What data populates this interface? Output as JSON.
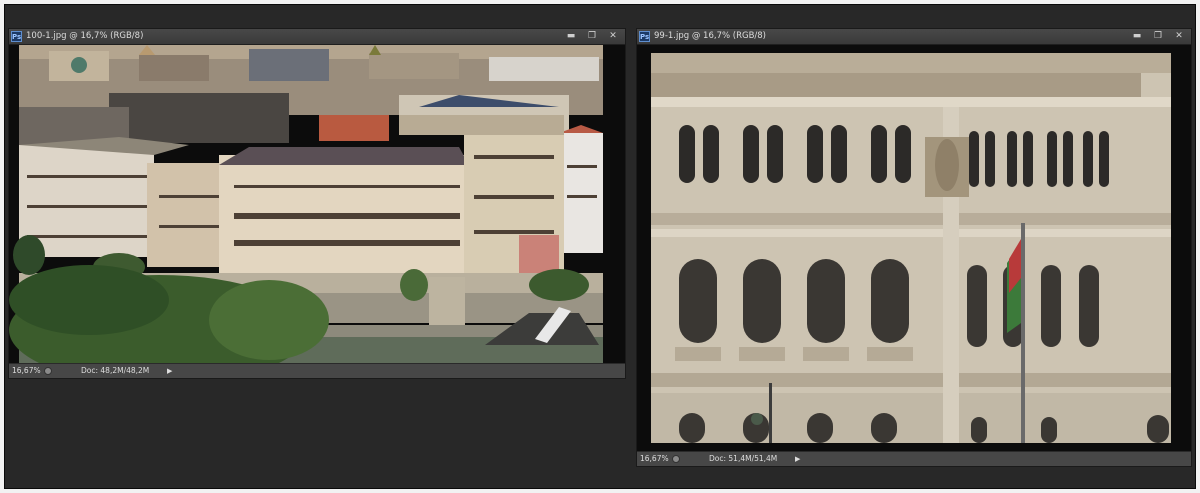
{
  "windows": [
    {
      "title": "100-1.jpg @ 16,7% (RGB/8)",
      "app_icon": "Ps",
      "controls": [
        "minimize-icon",
        "restore-icon",
        "close-icon"
      ],
      "zoom": "16,67%",
      "doc_info": "Doc: 48,2M/48,2M"
    },
    {
      "title": "99-1.jpg @ 16,7% (RGB/8)",
      "app_icon": "Ps",
      "controls": [
        "minimize-icon",
        "restore-icon",
        "close-icon"
      ],
      "zoom": "16,67%",
      "doc_info": "Doc: 51,4M/51,4M"
    }
  ],
  "glyphs": {
    "minimize": "▬",
    "restore": "❐",
    "close": "✕",
    "menu_arrow": "▶"
  },
  "colors": {
    "workspace": "#282828",
    "panel": "#535353",
    "ps_icon": "#1c3a66"
  }
}
